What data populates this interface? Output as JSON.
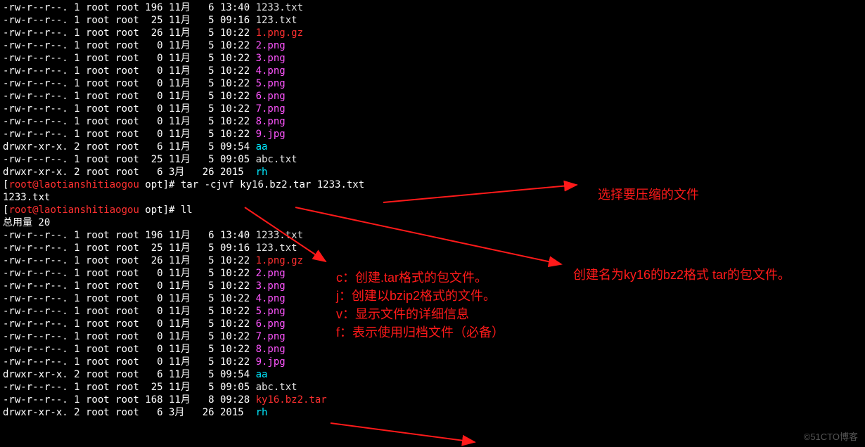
{
  "listing1": [
    {
      "perm": "-rw-r--r--.",
      "links": "1",
      "user": "root",
      "group": "root",
      "size": "196",
      "month": "11月",
      "day": "  6",
      "time": "13:40",
      "name": "1233.txt",
      "cls": "white"
    },
    {
      "perm": "-rw-r--r--.",
      "links": "1",
      "user": "root",
      "group": "root",
      "size": " 25",
      "month": "11月",
      "day": "  5",
      "time": "09:16",
      "name": "123.txt",
      "cls": "white"
    },
    {
      "perm": "-rw-r--r--.",
      "links": "1",
      "user": "root",
      "group": "root",
      "size": " 26",
      "month": "11月",
      "day": "  5",
      "time": "10:22",
      "name": "1.png.gz",
      "cls": "red"
    },
    {
      "perm": "-rw-r--r--.",
      "links": "1",
      "user": "root",
      "group": "root",
      "size": "  0",
      "month": "11月",
      "day": "  5",
      "time": "10:22",
      "name": "2.png",
      "cls": "magenta"
    },
    {
      "perm": "-rw-r--r--.",
      "links": "1",
      "user": "root",
      "group": "root",
      "size": "  0",
      "month": "11月",
      "day": "  5",
      "time": "10:22",
      "name": "3.png",
      "cls": "magenta"
    },
    {
      "perm": "-rw-r--r--.",
      "links": "1",
      "user": "root",
      "group": "root",
      "size": "  0",
      "month": "11月",
      "day": "  5",
      "time": "10:22",
      "name": "4.png",
      "cls": "magenta"
    },
    {
      "perm": "-rw-r--r--.",
      "links": "1",
      "user": "root",
      "group": "root",
      "size": "  0",
      "month": "11月",
      "day": "  5",
      "time": "10:22",
      "name": "5.png",
      "cls": "magenta"
    },
    {
      "perm": "-rw-r--r--.",
      "links": "1",
      "user": "root",
      "group": "root",
      "size": "  0",
      "month": "11月",
      "day": "  5",
      "time": "10:22",
      "name": "6.png",
      "cls": "magenta"
    },
    {
      "perm": "-rw-r--r--.",
      "links": "1",
      "user": "root",
      "group": "root",
      "size": "  0",
      "month": "11月",
      "day": "  5",
      "time": "10:22",
      "name": "7.png",
      "cls": "magenta"
    },
    {
      "perm": "-rw-r--r--.",
      "links": "1",
      "user": "root",
      "group": "root",
      "size": "  0",
      "month": "11月",
      "day": "  5",
      "time": "10:22",
      "name": "8.png",
      "cls": "magenta"
    },
    {
      "perm": "-rw-r--r--.",
      "links": "1",
      "user": "root",
      "group": "root",
      "size": "  0",
      "month": "11月",
      "day": "  5",
      "time": "10:22",
      "name": "9.jpg",
      "cls": "magenta"
    },
    {
      "perm": "drwxr-xr-x.",
      "links": "2",
      "user": "root",
      "group": "root",
      "size": "  6",
      "month": "11月",
      "day": "  5",
      "time": "09:54",
      "name": "aa",
      "cls": "cyan"
    },
    {
      "perm": "-rw-r--r--.",
      "links": "1",
      "user": "root",
      "group": "root",
      "size": " 25",
      "month": "11月",
      "day": "  5",
      "time": "09:05",
      "name": "abc.txt",
      "cls": "white"
    },
    {
      "perm": "drwxr-xr-x.",
      "links": "2",
      "user": "root",
      "group": "root",
      "size": "  6",
      "month": "3月 ",
      "day": " 26",
      "time": "2015 ",
      "name": "rh",
      "cls": "cyan"
    }
  ],
  "cmd1": {
    "prompt_open": "[",
    "user": "root@laotianshitiaogou",
    "path": " opt",
    "prompt_close": "]# ",
    "cmd": "tar -cjvf ky16.bz2.tar 1233.txt"
  },
  "cmd1_output": "1233.txt",
  "cmd2": {
    "prompt_open": "[",
    "user": "root@laotianshitiaogou",
    "path": " opt",
    "prompt_close": "]# ",
    "cmd": "ll"
  },
  "total_line": "总用量 20",
  "listing2": [
    {
      "perm": "-rw-r--r--.",
      "links": "1",
      "user": "root",
      "group": "root",
      "size": "196",
      "month": "11月",
      "day": "  6",
      "time": "13:40",
      "name": "1233.txt",
      "cls": "white"
    },
    {
      "perm": "-rw-r--r--.",
      "links": "1",
      "user": "root",
      "group": "root",
      "size": " 25",
      "month": "11月",
      "day": "  5",
      "time": "09:16",
      "name": "123.txt",
      "cls": "white"
    },
    {
      "perm": "-rw-r--r--.",
      "links": "1",
      "user": "root",
      "group": "root",
      "size": " 26",
      "month": "11月",
      "day": "  5",
      "time": "10:22",
      "name": "1.png.gz",
      "cls": "red"
    },
    {
      "perm": "-rw-r--r--.",
      "links": "1",
      "user": "root",
      "group": "root",
      "size": "  0",
      "month": "11月",
      "day": "  5",
      "time": "10:22",
      "name": "2.png",
      "cls": "magenta"
    },
    {
      "perm": "-rw-r--r--.",
      "links": "1",
      "user": "root",
      "group": "root",
      "size": "  0",
      "month": "11月",
      "day": "  5",
      "time": "10:22",
      "name": "3.png",
      "cls": "magenta"
    },
    {
      "perm": "-rw-r--r--.",
      "links": "1",
      "user": "root",
      "group": "root",
      "size": "  0",
      "month": "11月",
      "day": "  5",
      "time": "10:22",
      "name": "4.png",
      "cls": "magenta"
    },
    {
      "perm": "-rw-r--r--.",
      "links": "1",
      "user": "root",
      "group": "root",
      "size": "  0",
      "month": "11月",
      "day": "  5",
      "time": "10:22",
      "name": "5.png",
      "cls": "magenta"
    },
    {
      "perm": "-rw-r--r--.",
      "links": "1",
      "user": "root",
      "group": "root",
      "size": "  0",
      "month": "11月",
      "day": "  5",
      "time": "10:22",
      "name": "6.png",
      "cls": "magenta"
    },
    {
      "perm": "-rw-r--r--.",
      "links": "1",
      "user": "root",
      "group": "root",
      "size": "  0",
      "month": "11月",
      "day": "  5",
      "time": "10:22",
      "name": "7.png",
      "cls": "magenta"
    },
    {
      "perm": "-rw-r--r--.",
      "links": "1",
      "user": "root",
      "group": "root",
      "size": "  0",
      "month": "11月",
      "day": "  5",
      "time": "10:22",
      "name": "8.png",
      "cls": "magenta"
    },
    {
      "perm": "-rw-r--r--.",
      "links": "1",
      "user": "root",
      "group": "root",
      "size": "  0",
      "month": "11月",
      "day": "  5",
      "time": "10:22",
      "name": "9.jpg",
      "cls": "magenta"
    },
    {
      "perm": "drwxr-xr-x.",
      "links": "2",
      "user": "root",
      "group": "root",
      "size": "  6",
      "month": "11月",
      "day": "  5",
      "time": "09:54",
      "name": "aa",
      "cls": "cyan"
    },
    {
      "perm": "-rw-r--r--.",
      "links": "1",
      "user": "root",
      "group": "root",
      "size": " 25",
      "month": "11月",
      "day": "  5",
      "time": "09:05",
      "name": "abc.txt",
      "cls": "white"
    },
    {
      "perm": "-rw-r--r--.",
      "links": "1",
      "user": "root",
      "group": "root",
      "size": "168",
      "month": "11月",
      "day": "  8",
      "time": "09:28",
      "name": "ky16.bz2.tar",
      "cls": "red"
    },
    {
      "perm": "drwxr-xr-x.",
      "links": "2",
      "user": "root",
      "group": "root",
      "size": "  6",
      "month": "3月 ",
      "day": " 26",
      "time": "2015 ",
      "name": "rh",
      "cls": "cyan"
    }
  ],
  "annotations": {
    "a1": "选择要压缩的文件",
    "a2": "创建名为ky16的bz2格式 tar的包文件。",
    "explain": [
      "c：创建.tar格式的包文件。",
      "j：创建以bzip2格式的文件。",
      "v：显示文件的详细信息",
      "f：表示使用归档文件（必备）"
    ]
  },
  "watermark": "©51CTO博客"
}
